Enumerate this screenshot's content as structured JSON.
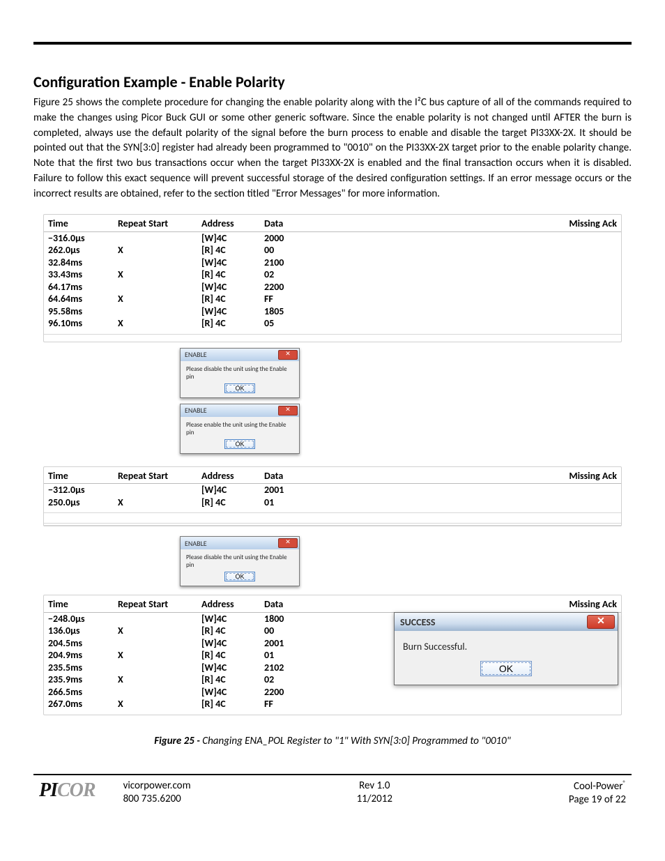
{
  "heading": "Configuration Example - Enable Polarity",
  "paragraph": "Figure 25 shows the complete procedure for changing the enable polarity along with the  I²C bus capture of all of the commands required to make the changes using Picor Buck GUI or some other generic software. Since the enable polarity is not changed until AFTER the burn is completed, always use the default polarity of the signal before the burn process to enable and disable the target PI33XX-2X. It should be pointed out that the SYN[3:0] register had already been programmed to \"0010\" on the PI33XX-2X target prior to the enable polarity change. Note that the first two bus transactions occur when the target PI33XX-2X is enabled and the final transaction occurs when it is disabled. Failure to follow this exact sequence will prevent successful storage of the desired configuration settings. If an error message occurs or the incorrect results are obtained, refer to the section titled \"Error Messages\" for more information.",
  "cap_headers": {
    "time": "Time",
    "repeat": "Repeat Start",
    "addr": "Address",
    "data": "Data",
    "ack": "Missing Ack"
  },
  "table1": [
    {
      "time": "−316.0µs",
      "rep": "",
      "addr": "[W]4C",
      "data": "2000"
    },
    {
      "time": "262.0µs",
      "rep": "X",
      "addr": "[R] 4C",
      "data": "00"
    },
    {
      "time": "32.84ms",
      "rep": "",
      "addr": "[W]4C",
      "data": "2100"
    },
    {
      "time": "33.43ms",
      "rep": "X",
      "addr": "[R] 4C",
      "data": "02"
    },
    {
      "time": "64.17ms",
      "rep": "",
      "addr": "[W]4C",
      "data": "2200"
    },
    {
      "time": "64.64ms",
      "rep": "X",
      "addr": "[R] 4C",
      "data": "FF"
    },
    {
      "time": "95.58ms",
      "rep": "",
      "addr": "[W]4C",
      "data": "1805"
    },
    {
      "time": "96.10ms",
      "rep": "X",
      "addr": "[R] 4C",
      "data": "05"
    }
  ],
  "dlg1": {
    "title": "ENABLE",
    "msg": "Please disable the unit using the Enable pin",
    "ok": "OK"
  },
  "dlg2": {
    "title": "ENABLE",
    "msg": "Please enable the unit using the Enable pin",
    "ok": "OK"
  },
  "table2": [
    {
      "time": "−312.0µs",
      "rep": "",
      "addr": "[W]4C",
      "data": "2001"
    },
    {
      "time": "250.0µs",
      "rep": "X",
      "addr": "[R] 4C",
      "data": "01"
    }
  ],
  "dlg3": {
    "title": "ENABLE",
    "msg": "Please disable the unit using the Enable pin",
    "ok": "OK"
  },
  "table3": [
    {
      "time": "−248.0µs",
      "rep": "",
      "addr": "[W]4C",
      "data": "1800"
    },
    {
      "time": "136.0µs",
      "rep": "X",
      "addr": "[R] 4C",
      "data": "00"
    },
    {
      "time": "204.5ms",
      "rep": "",
      "addr": "[W]4C",
      "data": "2001"
    },
    {
      "time": "204.9ms",
      "rep": "X",
      "addr": "[R] 4C",
      "data": "01"
    },
    {
      "time": "235.5ms",
      "rep": "",
      "addr": "[W]4C",
      "data": "2102"
    },
    {
      "time": "235.9ms",
      "rep": "X",
      "addr": "[R] 4C",
      "data": "02"
    },
    {
      "time": "266.5ms",
      "rep": "",
      "addr": "[W]4C",
      "data": "2200"
    },
    {
      "time": "267.0ms",
      "rep": "X",
      "addr": "[R] 4C",
      "data": "FF"
    }
  ],
  "success": {
    "title": "SUCCESS",
    "msg": "Burn Successful.",
    "ok": "OK"
  },
  "caption_strong": "Figure 25 - ",
  "caption_rest": "Changing ENA_POL Register to \"1\" With SYN[3:0] Programmed to \"0010\"",
  "footer": {
    "logo_a": "PI",
    "logo_b": "COR",
    "web": "vicorpower.com",
    "phone": "800 735.6200",
    "rev": "Rev 1.0",
    "date": "11/2012",
    "prod": "Cool-Power",
    "page": "Page 19 of 22"
  }
}
